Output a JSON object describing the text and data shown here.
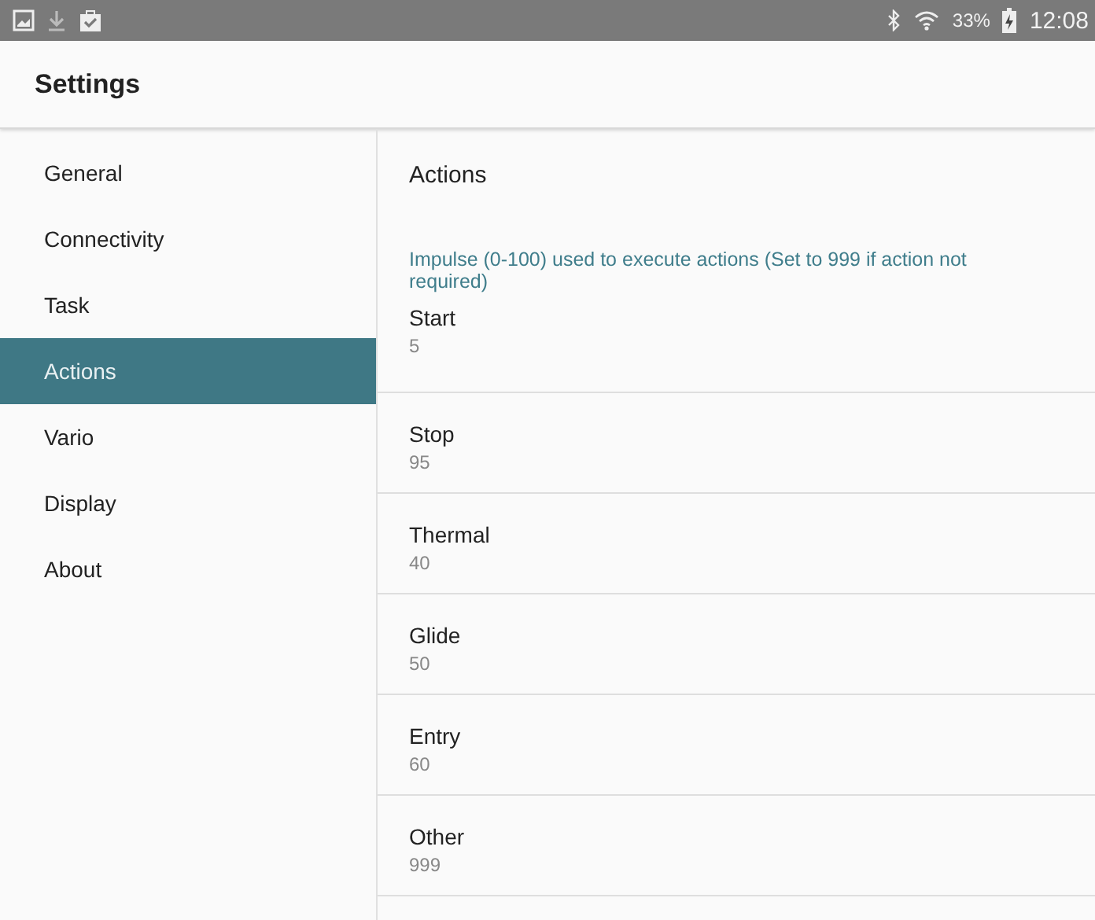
{
  "status_bar": {
    "battery": "33%",
    "time": "12:08"
  },
  "header": {
    "title": "Settings"
  },
  "sidebar": {
    "items": [
      {
        "label": "General",
        "selected": false
      },
      {
        "label": "Connectivity",
        "selected": false
      },
      {
        "label": "Task",
        "selected": false
      },
      {
        "label": "Actions",
        "selected": true
      },
      {
        "label": "Vario",
        "selected": false
      },
      {
        "label": "Display",
        "selected": false
      },
      {
        "label": "About",
        "selected": false
      }
    ]
  },
  "content": {
    "title": "Actions",
    "hint": "Impulse (0-100) used to execute actions (Set to 999 if action not required)",
    "settings": [
      {
        "label": "Start",
        "value": "5"
      },
      {
        "label": "Stop",
        "value": "95"
      },
      {
        "label": "Thermal",
        "value": "40"
      },
      {
        "label": "Glide",
        "value": "50"
      },
      {
        "label": "Entry",
        "value": "60"
      },
      {
        "label": "Other",
        "value": "999"
      }
    ]
  }
}
